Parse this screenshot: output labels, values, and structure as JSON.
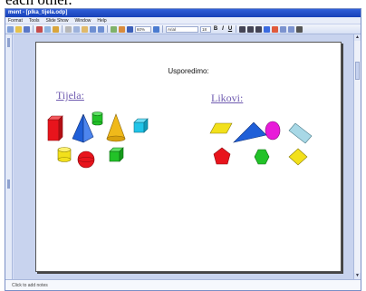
{
  "caption": "each other.",
  "window": {
    "title": "ment - [plka_tijela.odp]"
  },
  "menu": [
    "Format",
    "Tools",
    "Slide Show",
    "Window",
    "Help"
  ],
  "toolbar": {
    "zoom": "60%",
    "font": "Arial",
    "font_size": "18",
    "bold": "B",
    "italic": "I",
    "underline": "U"
  },
  "slide": {
    "title": "Usporedimo:",
    "left_label": "Tijela:",
    "right_label": "Likovi:"
  },
  "notes_placeholder": "Click to add notes",
  "shape_colors": {
    "red": "#e8141c",
    "blue": "#1f5fd8",
    "green": "#22c228",
    "yellow": "#f2e01b",
    "cyan": "#20c4e8",
    "magenta": "#e81ad9",
    "lightblue": "#a8d8e6",
    "orange": "#f0b91a"
  }
}
